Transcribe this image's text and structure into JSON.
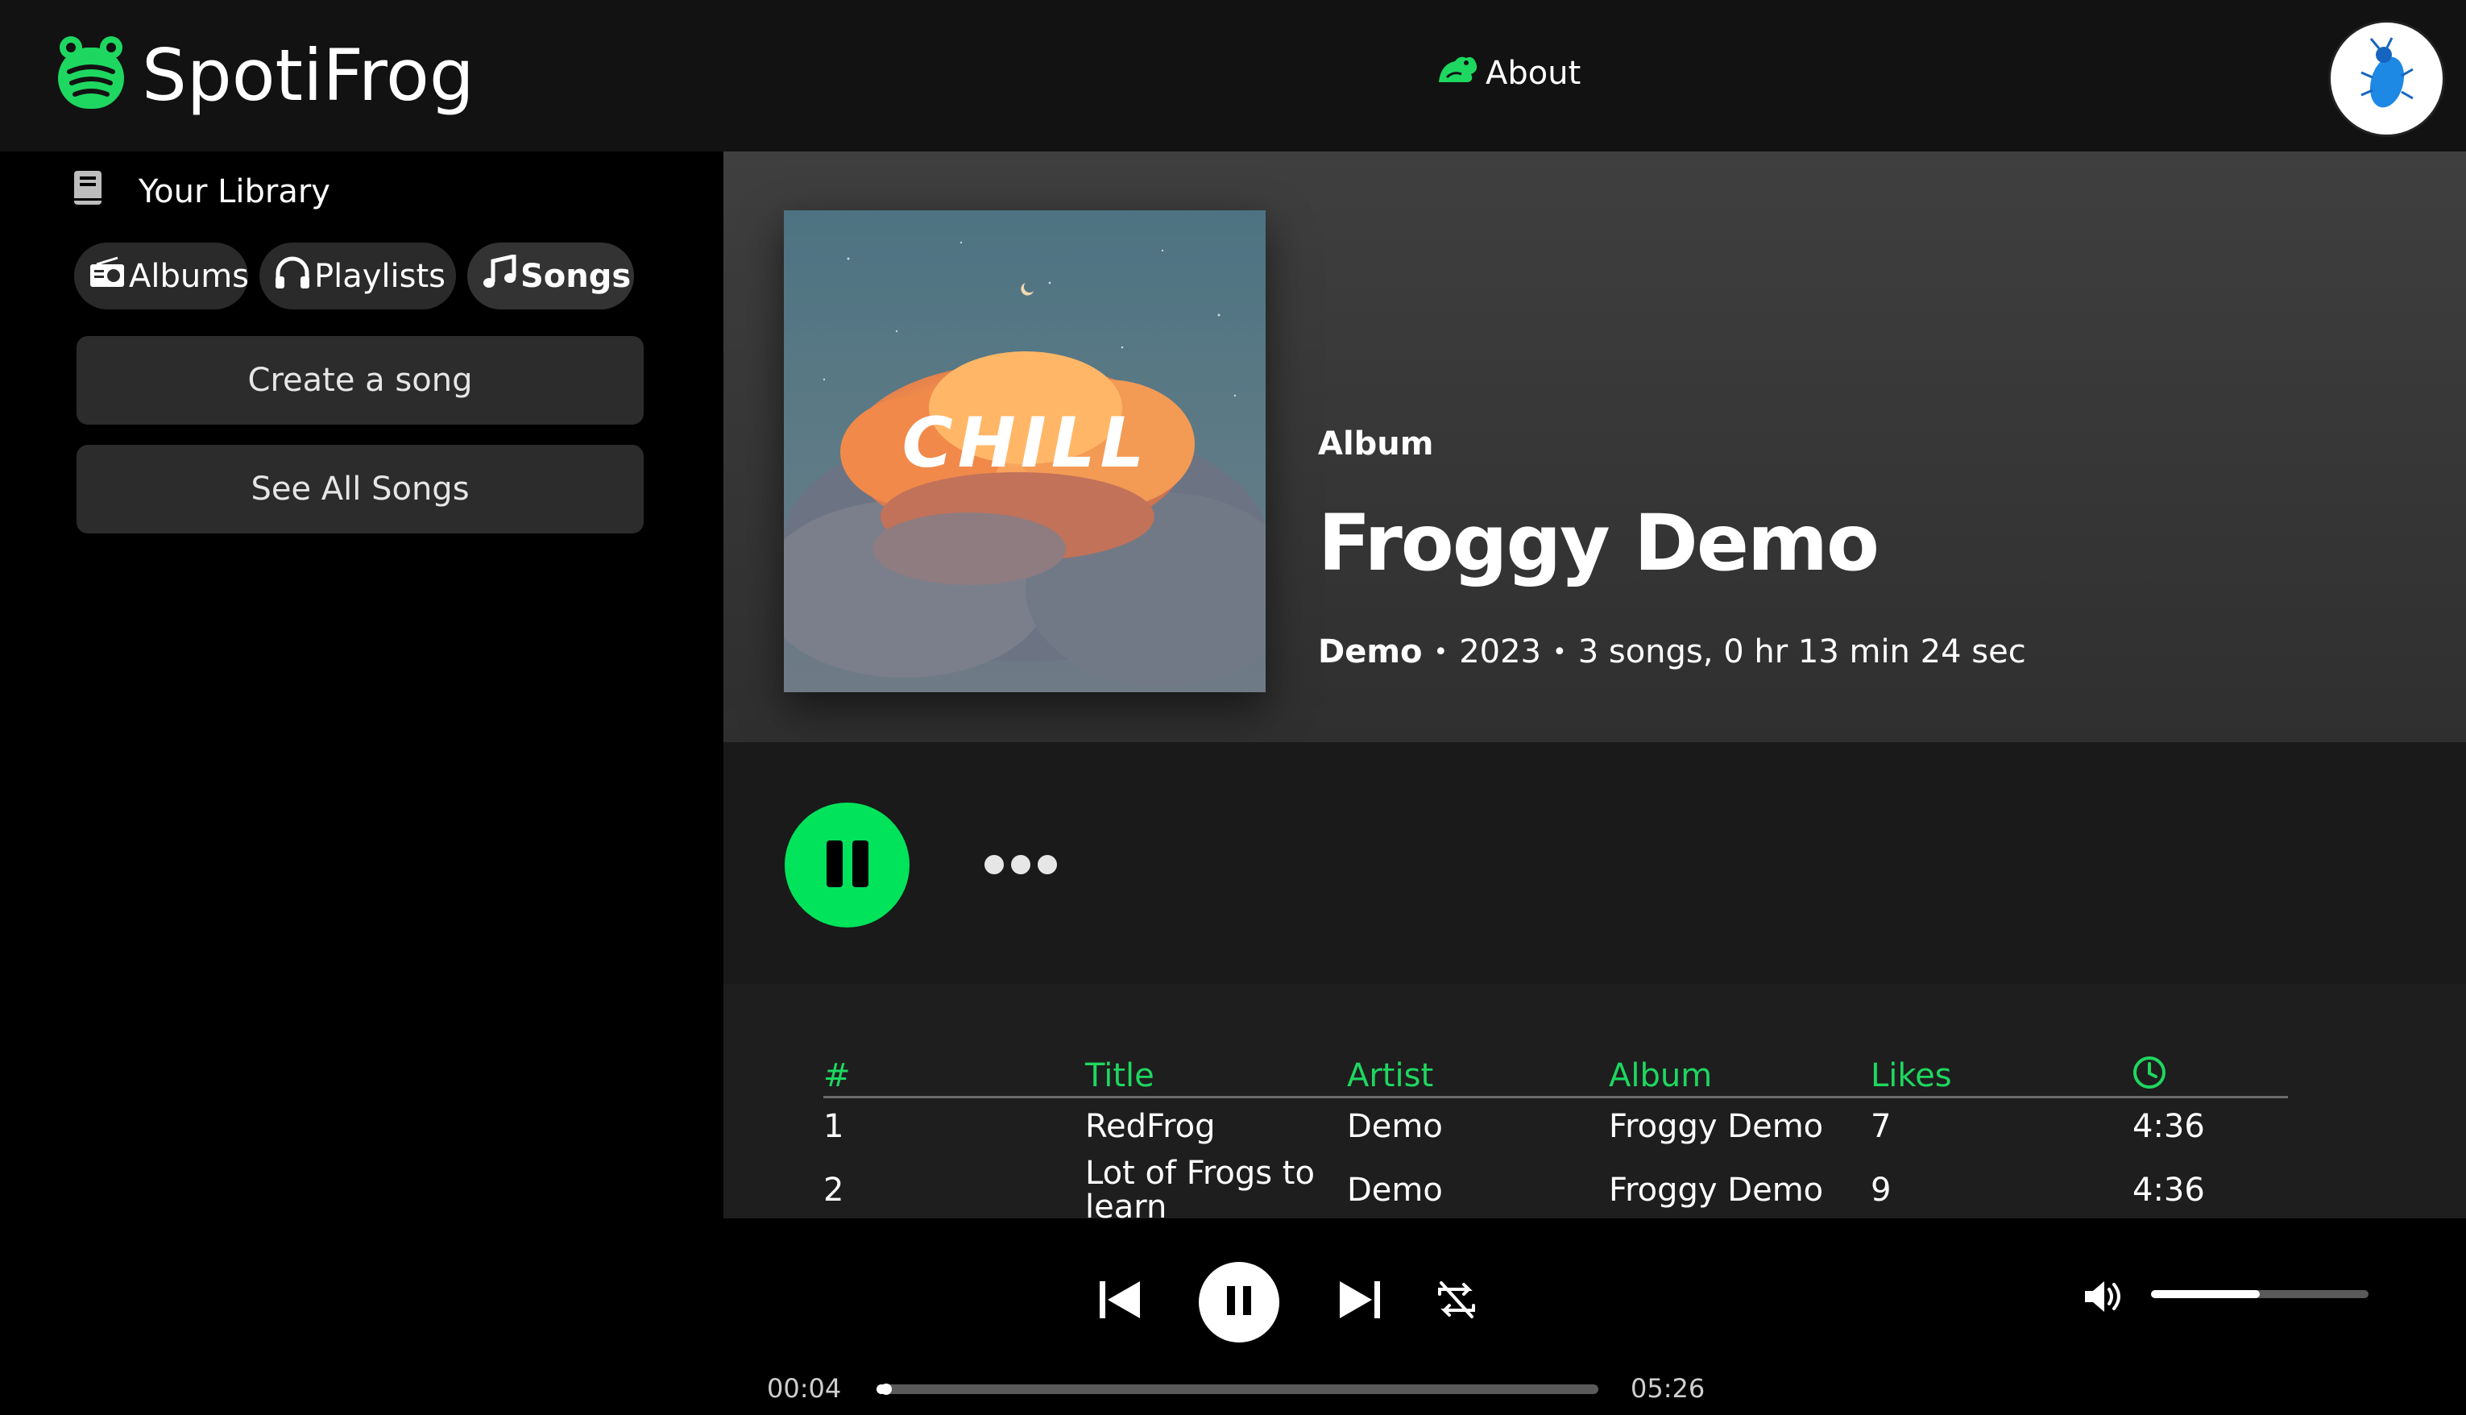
{
  "brand": {
    "name": "SpotiFrog",
    "accent": "#1ed760",
    "play_green": "#00e35a"
  },
  "nav": {
    "about_label": "About"
  },
  "sidebar": {
    "library_label": "Your Library",
    "chips": [
      {
        "label": "Albums",
        "icon": "radio-icon"
      },
      {
        "label": "Playlists",
        "icon": "headphones-icon"
      },
      {
        "label": "Songs",
        "icon": "music-note-icon"
      }
    ],
    "create_song_label": "Create a song",
    "see_all_label": "See All Songs"
  },
  "album": {
    "kind": "Album",
    "title": "Froggy Demo",
    "artist": "Demo",
    "year": "2023",
    "summary": "3 songs, 0 hr 13 min 24 sec",
    "cover_text": "CHILL"
  },
  "tracks": {
    "headers": [
      "#",
      "Title",
      "Artist",
      "Album",
      "Likes"
    ],
    "duration_icon": "clock-icon",
    "rows": [
      {
        "num": "1",
        "title": "RedFrog",
        "artist": "Demo",
        "album": "Froggy Demo",
        "likes": "7",
        "duration": "4:36"
      },
      {
        "num": "2",
        "title": "Lot of Frogs to learn",
        "artist": "Demo",
        "album": "Froggy Demo",
        "likes": "9",
        "duration": "4:36"
      }
    ]
  },
  "player": {
    "elapsed": "00:04",
    "total": "05:26",
    "progress_fraction": 0.013,
    "volume_fraction": 0.5
  }
}
